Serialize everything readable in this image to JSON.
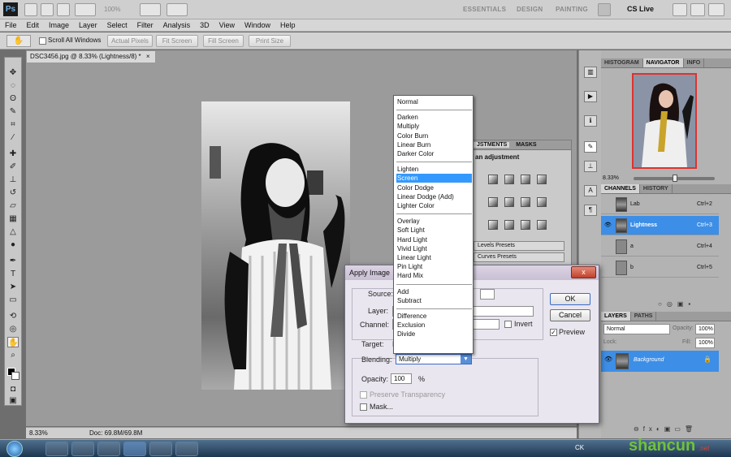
{
  "app": {
    "logo": "Ps",
    "zoom": "100%",
    "workspaces": [
      "ESSENTIALS",
      "DESIGN",
      "PAINTING"
    ],
    "cs_live": "CS Live"
  },
  "menu": [
    "File",
    "Edit",
    "Image",
    "Layer",
    "Select",
    "Filter",
    "Analysis",
    "3D",
    "View",
    "Window",
    "Help"
  ],
  "options_bar": {
    "scroll_all": "Scroll All Windows",
    "buttons": [
      "Actual Pixels",
      "Fit Screen",
      "Fill Screen",
      "Print Size"
    ]
  },
  "document": {
    "tab_title": "DSC3456.jpg @ 8.33% (Lightness/8) *",
    "close": "×"
  },
  "status": {
    "zoom": "8.33%",
    "doc": "Doc: 69.8M/69.8M"
  },
  "navigator": {
    "tabs": [
      "HISTOGRAM",
      "NAVIGATOR",
      "INFO"
    ],
    "zoom": "8.33%"
  },
  "channels": {
    "tabs": [
      "CHANNELS",
      "HISTORY"
    ],
    "rows": [
      {
        "name": "Lab",
        "shortcut": "Ctrl+2"
      },
      {
        "name": "Lightness",
        "shortcut": "Ctrl+3"
      },
      {
        "name": "a",
        "shortcut": "Ctrl+4"
      },
      {
        "name": "b",
        "shortcut": "Ctrl+5"
      }
    ]
  },
  "layers": {
    "tabs": [
      "LAYERS",
      "PATHS"
    ],
    "mode": "Normal",
    "opacity_label": "Opacity:",
    "opacity": "100%",
    "lock_label": "Lock:",
    "fill_label": "Fill:",
    "fill": "100%",
    "layer_name": "Background"
  },
  "adjustments": {
    "tabs": [
      "ADJUSTMENTS",
      "MASKS"
    ],
    "tab_prefix_visible": "JSTMENTS",
    "title": "an adjustment",
    "presets": [
      "Levels Presets",
      "Curves Presets"
    ]
  },
  "dialog": {
    "title": "Apply Image",
    "source_label": "Source:",
    "layer_label": "Layer:",
    "channel_label": "Channel:",
    "invert_label": "Invert",
    "target_label": "Target:",
    "target_value": "D",
    "blending_label": "Blending:",
    "blending_value": "Multiply",
    "opacity_label": "Opacity:",
    "opacity_value": "100",
    "percent": "%",
    "preserve_label": "Preserve Transparency",
    "mask_label": "Mask...",
    "ok": "OK",
    "cancel": "Cancel",
    "preview_label": "Preview",
    "close": "x"
  },
  "blend_modes": [
    [
      "Normal"
    ],
    [
      "Darken",
      "Multiply",
      "Color Burn",
      "Linear Burn",
      "Darker Color"
    ],
    [
      "Lighten",
      "Screen",
      "Color Dodge",
      "Linear Dodge (Add)",
      "Lighter Color"
    ],
    [
      "Overlay",
      "Soft Light",
      "Hard Light",
      "Vivid Light",
      "Linear Light",
      "Pin Light",
      "Hard Mix"
    ],
    [
      "Add",
      "Subtract"
    ],
    [
      "Difference",
      "Exclusion",
      "Divide"
    ]
  ],
  "blend_selected": "Screen",
  "taskbar": {
    "lang": "CK",
    "watermark": "shancun",
    "watermark_sub": ".net"
  },
  "colors": {
    "selection": "#3399ff",
    "panel": "#b3b3b3"
  }
}
